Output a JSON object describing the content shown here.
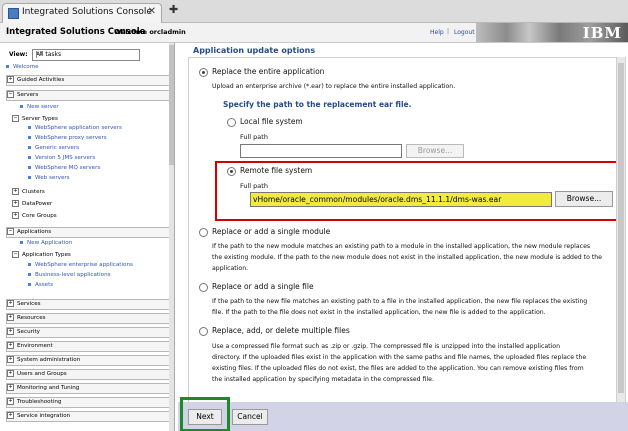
{
  "browser": {
    "tab_title": "Integrated Solutions Console",
    "tab_close": "✕",
    "new_tab": "✚"
  },
  "banner": {
    "brand": "Integrated Solutions Console",
    "welcome": "Welcome orcladmin",
    "help": "Help",
    "separator": "|",
    "logout": "Logout",
    "logo": "IBM"
  },
  "nav": {
    "view_label": "View:",
    "view_value": "All tasks",
    "welcome": "Welcome",
    "guided_activities": "Guided Activities",
    "servers": "Servers",
    "new_server": "New server",
    "server_types": "Server Types",
    "websphere_app_servers": "WebSphere application servers",
    "websphere_proxy_servers": "WebSphere proxy servers",
    "generic_servers": "Generic servers",
    "jms_servers": "Version 5 JMS servers",
    "mq_servers": "WebSphere MQ servers",
    "web_servers": "Web servers",
    "clusters": "Clusters",
    "datapower": "DataPower",
    "core_groups": "Core Groups",
    "applications": "Applications",
    "new_application": "New Application",
    "application_types": "Application Types",
    "enterprise_apps": "WebSphere enterprise applications",
    "business_apps": "Business-level applications",
    "assets": "Assets",
    "services": "Services",
    "resources": "Resources",
    "security": "Security",
    "environment": "Environment",
    "system_administration": "System administration",
    "users_groups": "Users and Groups",
    "monitoring": "Monitoring and Tuning",
    "troubleshooting": "Troubleshooting",
    "service_integration": "Service integration"
  },
  "main": {
    "section_title": "Application update options",
    "replace_entire": {
      "label": "Replace the entire application",
      "desc": "Upload an enterprise archive (*.ear) to replace the entire installed application.",
      "subhead": "Specify the path to the replacement ear file.",
      "local_label": "Local file system",
      "local_full_path": "Full path",
      "local_browse": "Browse...",
      "remote_label": "Remote file system",
      "remote_full_path": "Full path",
      "remote_value": "vHome/oracle_common/modules/oracle.dms_11.1.1/dms-was.ear",
      "remote_browse": "Browse..."
    },
    "replace_module": {
      "label": "Replace or add a single module",
      "desc1": "If the path to the new module matches an existing path to a module in the installed application, the new module replaces",
      "desc2": "the existing module. If the path to the new module does not exist in the installed application, the new module is added to the",
      "desc3": "application."
    },
    "replace_file": {
      "label": "Replace or add a single file",
      "desc1": "If the path to the new file matches an existing path to a file in the installed application, the new file replaces the existing",
      "desc2": "file. If the path to the file does not exist in the installed application, the new file is added to the application."
    },
    "replace_multiple": {
      "label": "Replace, add, or delete multiple files",
      "desc1": "Use a compressed file format such as .zip or .gzip. The compressed file is unzipped into the installed application",
      "desc2": "directory. If the uploaded files exist in the application with the same paths and file names, the uploaded files replace the",
      "desc3": "existing files. If the uploaded files do not exist, the files are added to the application. You can remove existing files from",
      "desc4": "the installed application by specifying metadata in the compressed file."
    },
    "next": "Next",
    "cancel": "Cancel"
  }
}
